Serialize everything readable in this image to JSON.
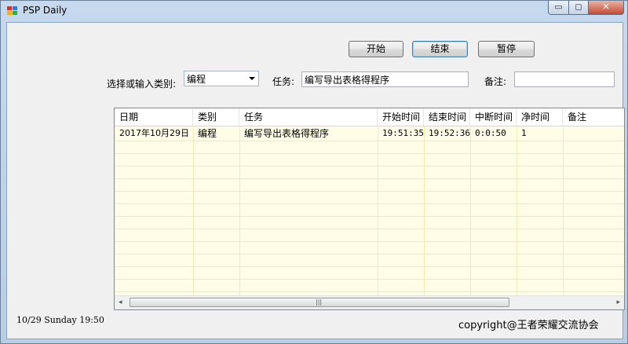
{
  "window": {
    "title": "PSP Daily",
    "controls": {
      "minimize": "▭",
      "maximize": "◻",
      "close": "✕"
    }
  },
  "toolbar": {
    "start_label": "开始",
    "end_label": "结束",
    "pause_label": "暂停"
  },
  "form": {
    "category_label": "选择或输入类别:",
    "category_value": "编程",
    "task_label": "任务:",
    "task_value": "编写导出表格得程序",
    "note_label": "备注:",
    "note_value": ""
  },
  "grid": {
    "columns": [
      "日期",
      "类别",
      "任务",
      "开始时间",
      "结束时间",
      "中断时间",
      "净时间",
      "备注"
    ],
    "rows": [
      [
        "2017年10月29日",
        "编程",
        "编写导出表格得程序",
        "19:51:35",
        "19:52:36",
        "0:0:50",
        "1",
        ""
      ]
    ],
    "scroll_left": "◂",
    "scroll_right": "▸",
    "scroll_grip": "|||"
  },
  "status": {
    "datetime": "10/29  Sunday 19:50"
  },
  "footer": {
    "copyright": "copyright@王者荣耀交流协会"
  },
  "colors": {
    "grid_background": "#fffde7",
    "title_bar": "#c7d9ee",
    "close_button": "#c44a32"
  }
}
